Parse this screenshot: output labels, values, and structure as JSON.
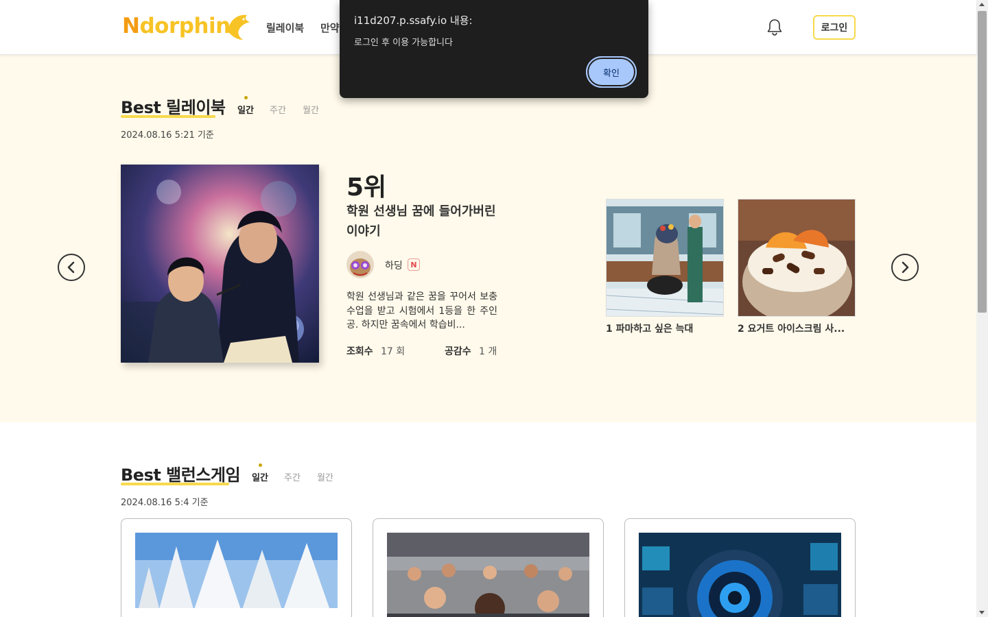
{
  "header": {
    "logo_text": "Ndorphin",
    "nav": [
      "릴레이북",
      "만약"
    ],
    "login_label": "로그인"
  },
  "dialog": {
    "title": "i11d207.p.ssafy.io 내용:",
    "message": "로그인 후 이용 가능합니다",
    "ok_label": "확인"
  },
  "relay": {
    "title": "Best 릴레이북",
    "tabs": [
      "일간",
      "주간",
      "월간"
    ],
    "active_tab": "일간",
    "timestamp": "2024.08.16 5:21 기준",
    "featured": {
      "rank": "5위",
      "title": "학원 선생님 꿈에 들어가버린 이야기",
      "author": "하딩",
      "author_badge": "N",
      "description": "학원 선생님과 같은 꿈을 꾸어서 보충 수업을 받고 시험에서 1등을 한 주인공. 하지만 꿈속에서 학습비...",
      "views_label": "조회수",
      "views_value": "17 회",
      "likes_label": "공감수",
      "likes_value": "1 개"
    },
    "side_items": [
      {
        "label": "1 파마하고 싶은 늑대"
      },
      {
        "label": "2 요거트 아이스크림 사..."
      }
    ]
  },
  "balance": {
    "title": "Best 밸런스게임",
    "tabs": [
      "일간",
      "주간",
      "월간"
    ],
    "active_tab": "일간",
    "timestamp": "2024.08.16 5:4 기준"
  },
  "colors": {
    "accent_yellow": "#f7d94c",
    "section_bg": "#fffaeb",
    "dialog_bg": "#1e1e1e",
    "dialog_button": "#a8c7fa"
  }
}
